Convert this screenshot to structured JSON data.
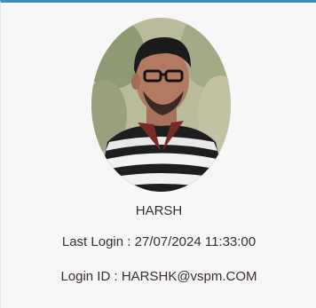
{
  "profile": {
    "avatar_icon": "user-photo",
    "name": "HARSH",
    "last_login_label": "Last Login : ",
    "last_login_value": "27/07/2024 11:33:00",
    "login_id_label": "Login ID : ",
    "login_id_value": "HARSHK@vspm.COM"
  },
  "colors": {
    "accent": "#3c8dbc",
    "card_bg": "#f7f7f7",
    "text": "#3a2f2f"
  }
}
